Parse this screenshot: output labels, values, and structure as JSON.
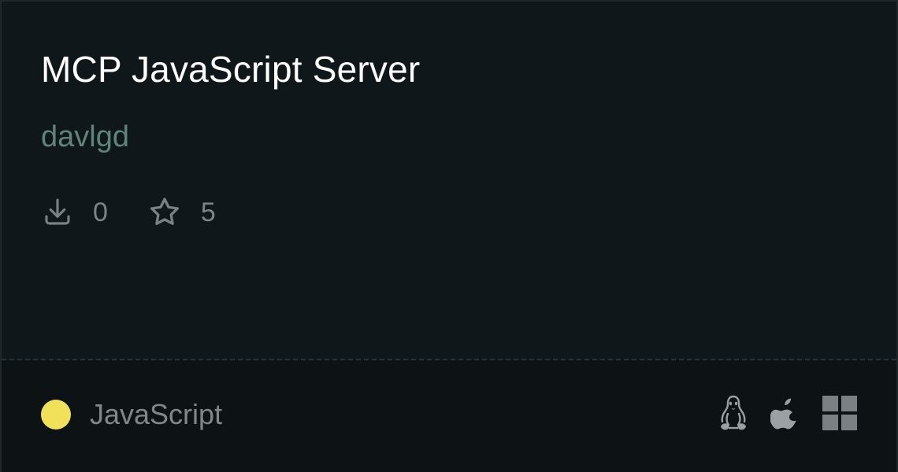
{
  "card": {
    "title": "MCP JavaScript Server",
    "author": "davlgd",
    "stats": {
      "downloads": {
        "icon": "download-icon",
        "value": "0"
      },
      "stars": {
        "icon": "star-icon",
        "value": "5"
      }
    },
    "language": {
      "name": "JavaScript",
      "color": "#f1e05a"
    },
    "platforms": [
      {
        "name": "linux",
        "icon": "linux-icon"
      },
      {
        "name": "macos",
        "icon": "apple-icon"
      },
      {
        "name": "windows",
        "icon": "windows-icon"
      }
    ]
  },
  "colors": {
    "background": "#10171a",
    "footer_background": "#0d1215",
    "title": "#ffffff",
    "author": "#5f8479",
    "muted": "#7c8487",
    "icon": "#7a8083"
  }
}
